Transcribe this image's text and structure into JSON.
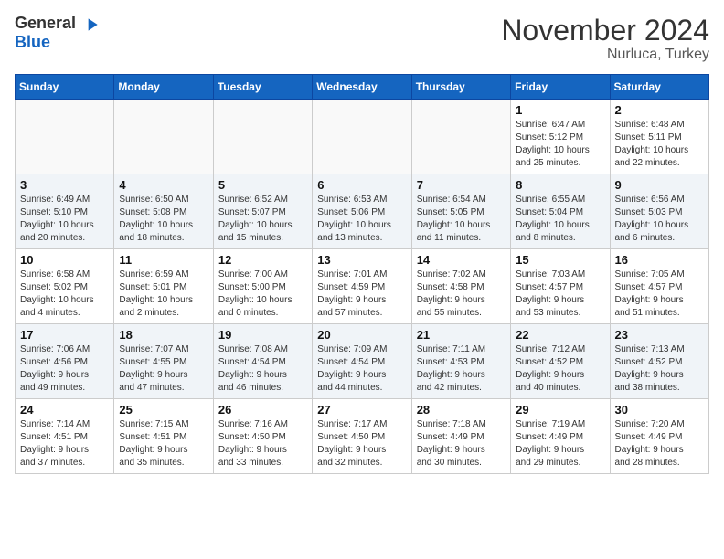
{
  "header": {
    "logo_general": "General",
    "logo_blue": "Blue",
    "month": "November 2024",
    "location": "Nurluca, Turkey"
  },
  "days_of_week": [
    "Sunday",
    "Monday",
    "Tuesday",
    "Wednesday",
    "Thursday",
    "Friday",
    "Saturday"
  ],
  "weeks": [
    [
      {
        "day": "",
        "info": ""
      },
      {
        "day": "",
        "info": ""
      },
      {
        "day": "",
        "info": ""
      },
      {
        "day": "",
        "info": ""
      },
      {
        "day": "",
        "info": ""
      },
      {
        "day": "1",
        "info": "Sunrise: 6:47 AM\nSunset: 5:12 PM\nDaylight: 10 hours\nand 25 minutes."
      },
      {
        "day": "2",
        "info": "Sunrise: 6:48 AM\nSunset: 5:11 PM\nDaylight: 10 hours\nand 22 minutes."
      }
    ],
    [
      {
        "day": "3",
        "info": "Sunrise: 6:49 AM\nSunset: 5:10 PM\nDaylight: 10 hours\nand 20 minutes."
      },
      {
        "day": "4",
        "info": "Sunrise: 6:50 AM\nSunset: 5:08 PM\nDaylight: 10 hours\nand 18 minutes."
      },
      {
        "day": "5",
        "info": "Sunrise: 6:52 AM\nSunset: 5:07 PM\nDaylight: 10 hours\nand 15 minutes."
      },
      {
        "day": "6",
        "info": "Sunrise: 6:53 AM\nSunset: 5:06 PM\nDaylight: 10 hours\nand 13 minutes."
      },
      {
        "day": "7",
        "info": "Sunrise: 6:54 AM\nSunset: 5:05 PM\nDaylight: 10 hours\nand 11 minutes."
      },
      {
        "day": "8",
        "info": "Sunrise: 6:55 AM\nSunset: 5:04 PM\nDaylight: 10 hours\nand 8 minutes."
      },
      {
        "day": "9",
        "info": "Sunrise: 6:56 AM\nSunset: 5:03 PM\nDaylight: 10 hours\nand 6 minutes."
      }
    ],
    [
      {
        "day": "10",
        "info": "Sunrise: 6:58 AM\nSunset: 5:02 PM\nDaylight: 10 hours\nand 4 minutes."
      },
      {
        "day": "11",
        "info": "Sunrise: 6:59 AM\nSunset: 5:01 PM\nDaylight: 10 hours\nand 2 minutes."
      },
      {
        "day": "12",
        "info": "Sunrise: 7:00 AM\nSunset: 5:00 PM\nDaylight: 10 hours\nand 0 minutes."
      },
      {
        "day": "13",
        "info": "Sunrise: 7:01 AM\nSunset: 4:59 PM\nDaylight: 9 hours\nand 57 minutes."
      },
      {
        "day": "14",
        "info": "Sunrise: 7:02 AM\nSunset: 4:58 PM\nDaylight: 9 hours\nand 55 minutes."
      },
      {
        "day": "15",
        "info": "Sunrise: 7:03 AM\nSunset: 4:57 PM\nDaylight: 9 hours\nand 53 minutes."
      },
      {
        "day": "16",
        "info": "Sunrise: 7:05 AM\nSunset: 4:57 PM\nDaylight: 9 hours\nand 51 minutes."
      }
    ],
    [
      {
        "day": "17",
        "info": "Sunrise: 7:06 AM\nSunset: 4:56 PM\nDaylight: 9 hours\nand 49 minutes."
      },
      {
        "day": "18",
        "info": "Sunrise: 7:07 AM\nSunset: 4:55 PM\nDaylight: 9 hours\nand 47 minutes."
      },
      {
        "day": "19",
        "info": "Sunrise: 7:08 AM\nSunset: 4:54 PM\nDaylight: 9 hours\nand 46 minutes."
      },
      {
        "day": "20",
        "info": "Sunrise: 7:09 AM\nSunset: 4:54 PM\nDaylight: 9 hours\nand 44 minutes."
      },
      {
        "day": "21",
        "info": "Sunrise: 7:11 AM\nSunset: 4:53 PM\nDaylight: 9 hours\nand 42 minutes."
      },
      {
        "day": "22",
        "info": "Sunrise: 7:12 AM\nSunset: 4:52 PM\nDaylight: 9 hours\nand 40 minutes."
      },
      {
        "day": "23",
        "info": "Sunrise: 7:13 AM\nSunset: 4:52 PM\nDaylight: 9 hours\nand 38 minutes."
      }
    ],
    [
      {
        "day": "24",
        "info": "Sunrise: 7:14 AM\nSunset: 4:51 PM\nDaylight: 9 hours\nand 37 minutes."
      },
      {
        "day": "25",
        "info": "Sunrise: 7:15 AM\nSunset: 4:51 PM\nDaylight: 9 hours\nand 35 minutes."
      },
      {
        "day": "26",
        "info": "Sunrise: 7:16 AM\nSunset: 4:50 PM\nDaylight: 9 hours\nand 33 minutes."
      },
      {
        "day": "27",
        "info": "Sunrise: 7:17 AM\nSunset: 4:50 PM\nDaylight: 9 hours\nand 32 minutes."
      },
      {
        "day": "28",
        "info": "Sunrise: 7:18 AM\nSunset: 4:49 PM\nDaylight: 9 hours\nand 30 minutes."
      },
      {
        "day": "29",
        "info": "Sunrise: 7:19 AM\nSunset: 4:49 PM\nDaylight: 9 hours\nand 29 minutes."
      },
      {
        "day": "30",
        "info": "Sunrise: 7:20 AM\nSunset: 4:49 PM\nDaylight: 9 hours\nand 28 minutes."
      }
    ]
  ]
}
